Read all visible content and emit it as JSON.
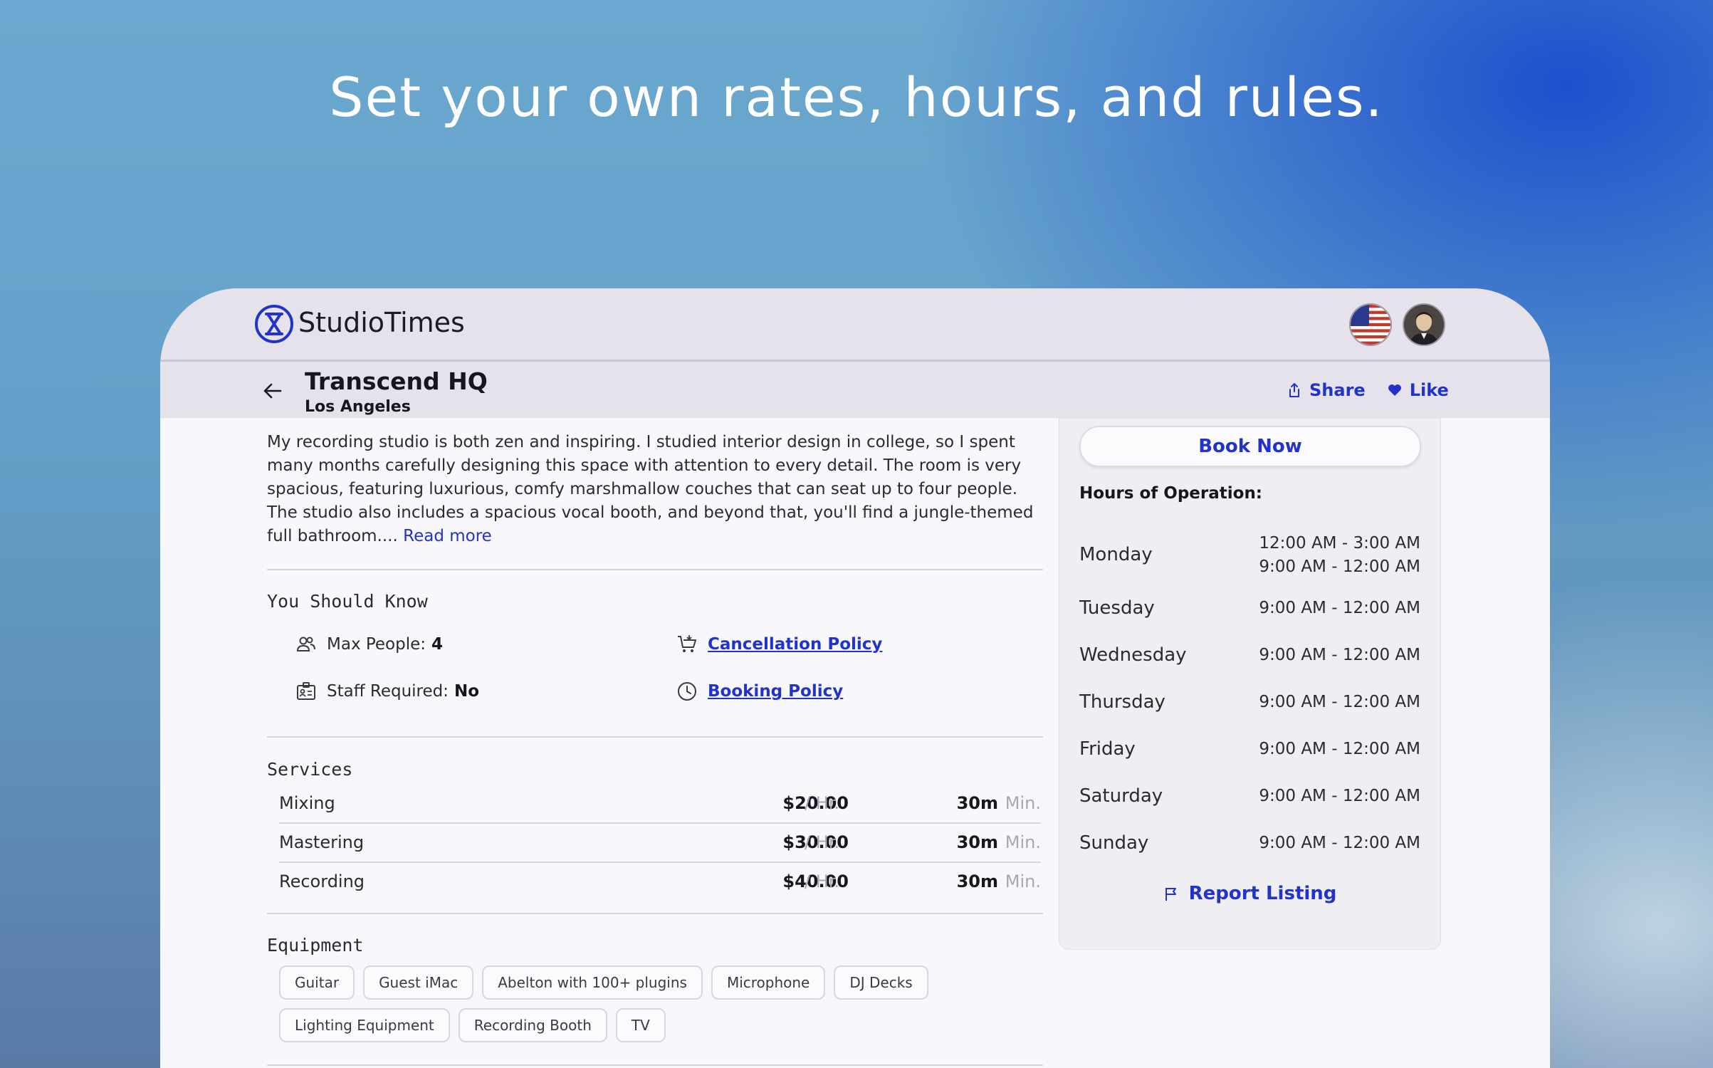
{
  "headline": "Set your own rates, hours, and rules.",
  "app": {
    "brand": "StudioTimes"
  },
  "colors": {
    "accent": "#2233cc",
    "window_bg": "#f8f7fc",
    "bar_bg": "#e5e2ec"
  },
  "studio": {
    "name": "Transcend HQ",
    "city": "Los Angeles"
  },
  "actions": {
    "share": "Share",
    "like": "Like"
  },
  "description": {
    "text": "My recording studio is both zen and inspiring. I studied interior design in college, so I spent many months carefully designing this space with attention to every detail. The room is very spacious, featuring luxurious, comfy marshmallow couches that can seat up to four people. The studio also includes a spacious vocal booth, and beyond that, you'll find a jungle-themed full bathroom....",
    "read_more": "Read more"
  },
  "know": {
    "title": "You Should Know",
    "max_people_label": "Max People:",
    "max_people_value": "4",
    "staff_label": "Staff Required:",
    "staff_value": "No",
    "cancellation": "Cancellation Policy",
    "booking": "Booking Policy"
  },
  "services": {
    "title": "Services",
    "rows": [
      {
        "name": "Mixing",
        "price": "$20.00",
        "per": "/ Hr.",
        "min": "30m",
        "min_label": "Min."
      },
      {
        "name": "Mastering",
        "price": "$30.00",
        "per": "/ Hr.",
        "min": "30m",
        "min_label": "Min."
      },
      {
        "name": "Recording",
        "price": "$40.00",
        "per": "/ Hr.",
        "min": "30m",
        "min_label": "Min."
      }
    ]
  },
  "equipment": {
    "title": "Equipment",
    "items": [
      "Guitar",
      "Guest iMac",
      "Abelton with 100+ plugins",
      "Microphone",
      "DJ Decks",
      "Lighting Equipment",
      "Recording Booth",
      "TV"
    ]
  },
  "sidebar": {
    "book": "Book Now",
    "hours_title": "Hours of Operation:",
    "days": [
      {
        "day": "Monday",
        "times": [
          "12:00 AM - 3:00 AM",
          "9:00 AM - 12:00 AM"
        ]
      },
      {
        "day": "Tuesday",
        "times": [
          "9:00 AM - 12:00 AM"
        ]
      },
      {
        "day": "Wednesday",
        "times": [
          "9:00 AM - 12:00 AM"
        ]
      },
      {
        "day": "Thursday",
        "times": [
          "9:00 AM - 12:00 AM"
        ]
      },
      {
        "day": "Friday",
        "times": [
          "9:00 AM - 12:00 AM"
        ]
      },
      {
        "day": "Saturday",
        "times": [
          "9:00 AM - 12:00 AM"
        ]
      },
      {
        "day": "Sunday",
        "times": [
          "9:00 AM - 12:00 AM"
        ]
      }
    ],
    "report": "Report Listing"
  }
}
